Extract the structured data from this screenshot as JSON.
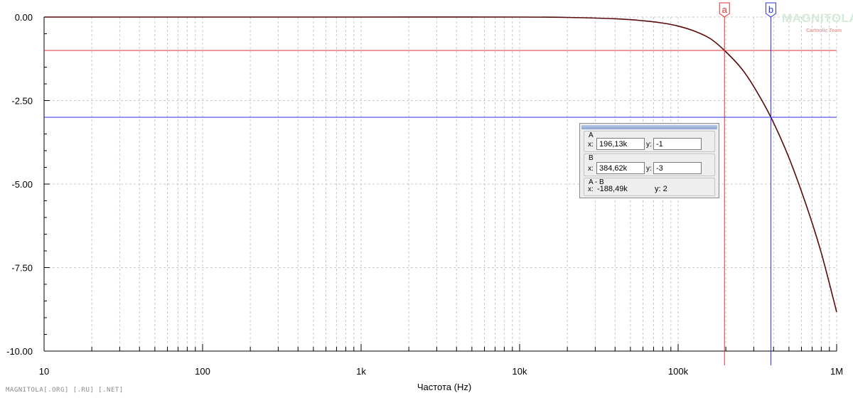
{
  "chart_data": {
    "type": "line",
    "xscale": "log",
    "xlabel": "Частота (Hz)",
    "ylabel": "",
    "xlim": [
      10,
      1000000
    ],
    "ylim": [
      -10,
      0
    ],
    "x_ticks": [
      10,
      100,
      1000,
      10000,
      100000,
      1000000
    ],
    "x_tick_labels": [
      "10",
      "100",
      "1k",
      "10k",
      "100k",
      "1M"
    ],
    "y_ticks": [
      0,
      -2.5,
      -5,
      -7.5,
      -10
    ],
    "y_tick_labels": [
      "0.00",
      "-2.50",
      "-5.00",
      "-7.50",
      "-10.00"
    ],
    "grid": true,
    "series": [
      {
        "color": "#5a0a0a",
        "x": [
          10,
          100,
          1000,
          10000,
          20000,
          40000,
          60000,
          80000,
          100000,
          130000,
          160000,
          196130,
          250000,
          300000,
          384620,
          500000,
          650000,
          800000,
          1000000
        ],
        "y": [
          0,
          0,
          0,
          0,
          -0.01,
          -0.05,
          -0.11,
          -0.18,
          -0.27,
          -0.44,
          -0.65,
          -1,
          -1.53,
          -2.08,
          -3,
          -4.21,
          -5.7,
          -7.06,
          -8.83
        ]
      }
    ],
    "cursors": [
      {
        "label": "a",
        "x": 196130,
        "y": -1,
        "color": "#e03030"
      },
      {
        "label": "b",
        "x": 384620,
        "y": -3,
        "color": "#3030e0"
      }
    ]
  },
  "readout": {
    "a_title": "A",
    "b_title": "B",
    "diff_title": "A - B",
    "x_prefix": "x:",
    "y_prefix": "y:",
    "a_x": "196,13k",
    "a_y": "-1",
    "b_x": "384,62k",
    "b_y": "-3",
    "diff_x": "-188,49k",
    "diff_y": "y: 2"
  },
  "logo": {
    "main": "MAGNITOLA",
    "sub": "Cartoolic Team"
  },
  "footer_watermark": "MAGNITOLA[.ORG] [.RU] [.NET]",
  "colors": {
    "curve": "#5a0a0a",
    "cursor_a": "#e03030",
    "cursor_b": "#3030e0",
    "grid": "#c8c8c8"
  }
}
